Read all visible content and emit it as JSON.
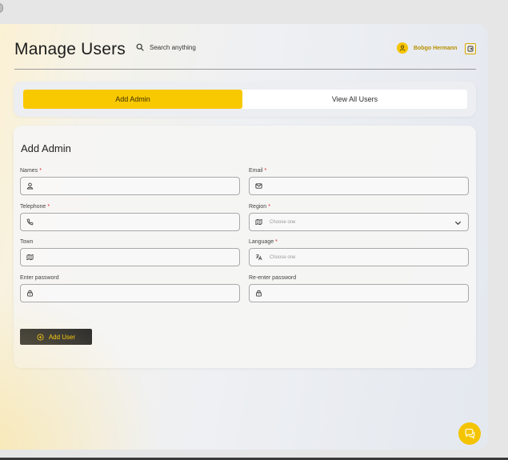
{
  "header": {
    "title": "Manage Users",
    "search_placeholder": "Search anything",
    "user_name": "Bobgo Hermann"
  },
  "tabs": [
    {
      "label": "Add Admin",
      "active": true
    },
    {
      "label": "View All Users",
      "active": false
    }
  ],
  "form": {
    "title": "Add Admin",
    "fields": {
      "names": {
        "label": "Names",
        "required": "*",
        "icon": "user-icon",
        "value": ""
      },
      "email": {
        "label": "Email",
        "required": "*",
        "icon": "mail-icon",
        "value": ""
      },
      "telephone": {
        "label": "Telephone",
        "required": "*",
        "icon": "phone-icon",
        "value": ""
      },
      "region": {
        "label": "Region",
        "required": "*",
        "icon": "map-icon",
        "placeholder": "Choose one"
      },
      "town": {
        "label": "Town",
        "required": "",
        "icon": "map-icon",
        "value": ""
      },
      "language": {
        "label": "Language",
        "required": "*",
        "icon": "translate-icon",
        "placeholder": "Choose one"
      },
      "password": {
        "label": "Enter password",
        "required": "",
        "icon": "lock-icon",
        "value": ""
      },
      "repassword": {
        "label": "Re-enter password",
        "required": "",
        "icon": "lock-icon",
        "value": ""
      }
    },
    "submit_label": "Add User"
  },
  "colors": {
    "accent": "#f8c800",
    "button_dark": "#2a2a2a",
    "required": "#dd2222"
  }
}
